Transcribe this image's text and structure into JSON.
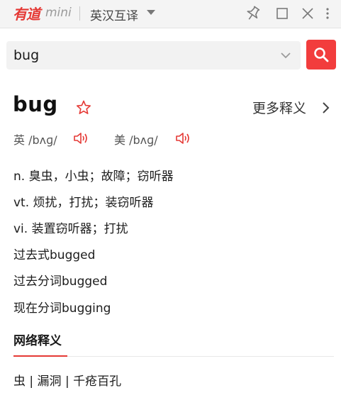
{
  "titlebar": {
    "logo": "有道",
    "logo_suffix": "mini",
    "mode": "英汉互译",
    "icons": [
      "pin-icon",
      "maximize-icon",
      "close-icon",
      "more-vertical-icon"
    ]
  },
  "search": {
    "query": "bug",
    "button_icon": "search-icon",
    "accent_color": "#f23d3d"
  },
  "entry": {
    "headword": "bug",
    "more_label": "更多释义",
    "uk_label": "英 /bʌɡ/",
    "us_label": "美 /bʌɡ/",
    "definitions": [
      "n. 臭虫，小虫；故障；窃听器",
      "vt. 烦扰，打扰；装窃听器",
      "vi. 装置窃听器；打扰",
      "过去式bugged",
      "过去分词bugged",
      "现在分词bugging"
    ]
  },
  "web": {
    "section_title": "网络释义",
    "meaning": "虫 | 漏洞 | 千疮百孔"
  }
}
